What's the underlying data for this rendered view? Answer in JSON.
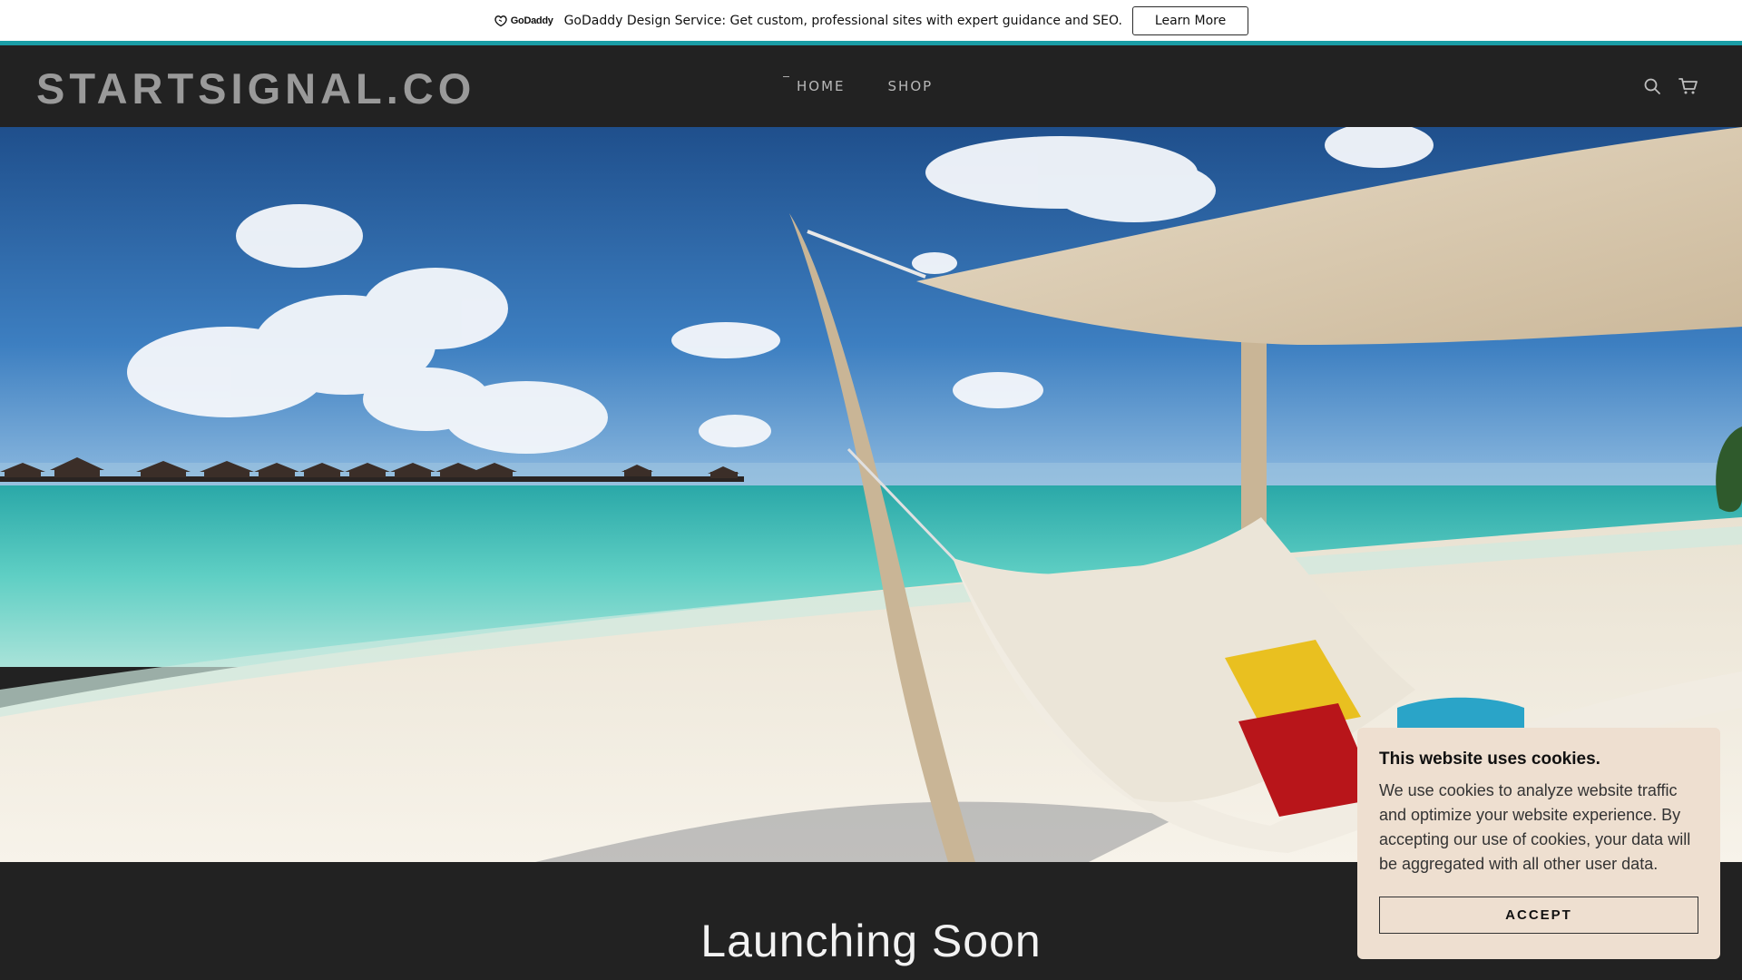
{
  "promo": {
    "logo_text": "GoDaddy",
    "message": "GoDaddy Design Service: Get custom, professional sites with expert guidance and SEO.",
    "button_label": "Learn More"
  },
  "header": {
    "brand": "STARTSIGNAL.CO",
    "nav": [
      {
        "label": "HOME",
        "active": true
      },
      {
        "label": "SHOP",
        "active": false
      }
    ],
    "icons": [
      "search-icon",
      "cart-icon"
    ]
  },
  "hero": {
    "image_description": "beach-hammock-photo"
  },
  "main": {
    "heading": "Launching Soon"
  },
  "cookie": {
    "title": "This website uses cookies.",
    "text": "We use cookies to analyze website traffic and optimize your website experience. By accepting our use of cookies, your data will be aggregated with all other user data.",
    "button_label": "ACCEPT"
  },
  "colors": {
    "accent": "#1a9da6",
    "header_bg": "#222222",
    "cookie_bg": "#eedfd0"
  }
}
